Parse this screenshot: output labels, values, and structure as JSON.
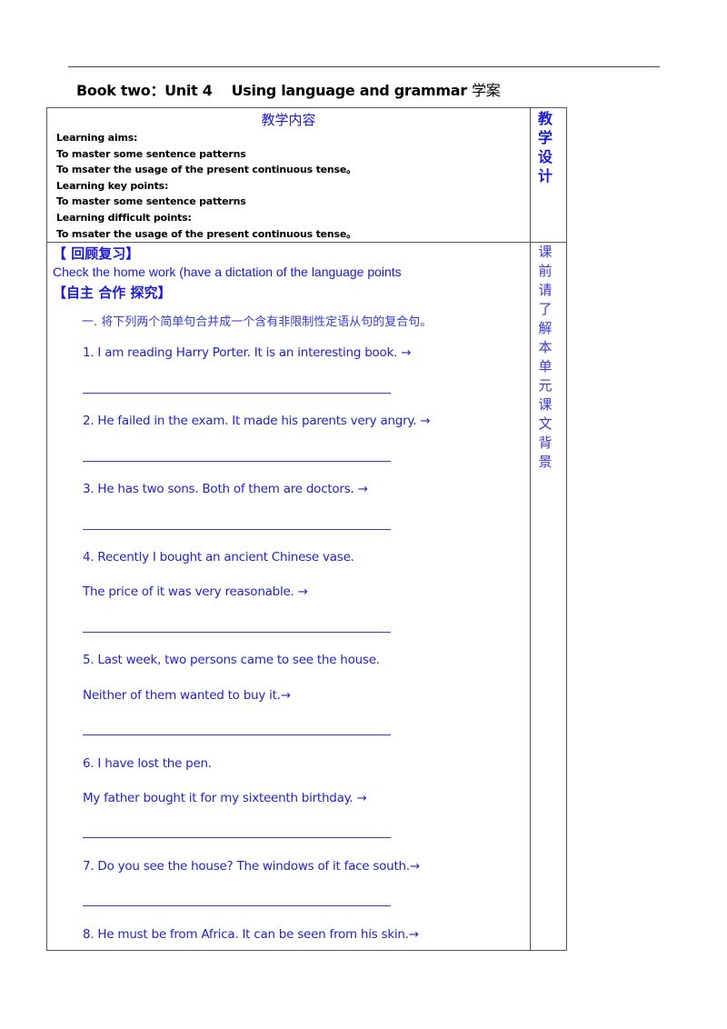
{
  "header": {
    "title_en": "Book two：Unit 4    Using language and grammar ",
    "title_cn": "学案"
  },
  "table": {
    "content_header": "教学内容",
    "design_header": [
      "教",
      "学",
      "设",
      "计"
    ],
    "learning": [
      "Learning aims:",
      "To master some sentence patterns",
      "To msater the usage of the present continuous tense。",
      "Learning key points:",
      "To master some sentence patterns",
      "Learning difficult points:",
      "To msater the usage of the present continuous tense。"
    ],
    "side_note": [
      "课",
      "前",
      "请",
      "了",
      "解",
      "本",
      "单",
      "元",
      "课",
      "文",
      "背",
      "景"
    ],
    "review_heading": "【  回顾复习】",
    "homework_text": "Check the home work (have a dictation of the language points",
    "explore_heading": "【自主  合作  探究】",
    "instruction": "一. 将下列两个简单句合并成一个含有非限制性定语从句的复合句。",
    "exercises": [
      {
        "lines": [
          "1. I am reading Harry Porter. It is an interesting book. →"
        ]
      },
      {
        "lines": [
          "2. He failed in the exam. It made his parents very angry. →"
        ]
      },
      {
        "lines": [
          "3. He has two sons. Both of them are doctors. →"
        ]
      },
      {
        "lines": [
          "4. Recently I bought an ancient Chinese vase.",
          " The price of it was very reasonable. →"
        ]
      },
      {
        "lines": [
          "5. Last week, two persons came to see the house.",
          "Neither of them wanted to buy it.→"
        ]
      },
      {
        "lines": [
          "6. I have lost the pen.",
          "My father bought it for my sixteenth birthday. →"
        ]
      },
      {
        "lines": [
          "7. Do you see the house? The windows of it face south.→"
        ]
      },
      {
        "lines": [
          "8. He must be from Africa. It can be seen from his skin.→"
        ]
      }
    ]
  }
}
